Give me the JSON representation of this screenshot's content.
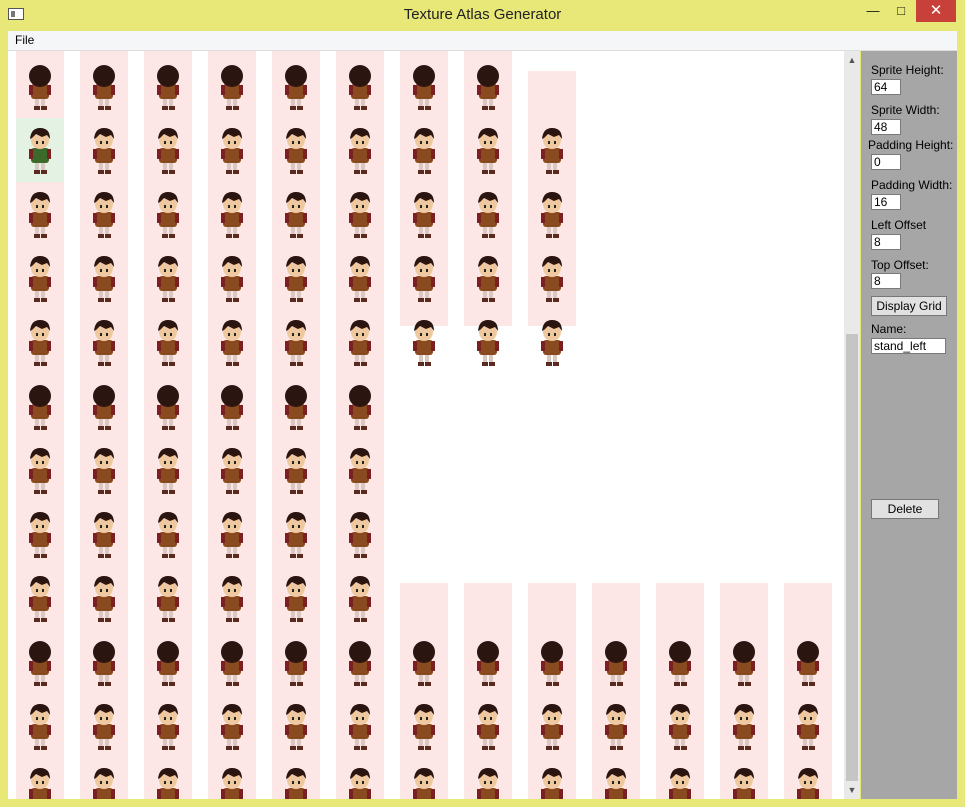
{
  "window": {
    "title": "Texture Atlas Generator",
    "minimize": "—",
    "maximize": "□",
    "close": "✕"
  },
  "menu": {
    "file": "File"
  },
  "sheet": {
    "columns": 13,
    "column_row_counts": [
      12,
      12,
      12,
      12,
      12,
      12,
      12,
      12,
      12,
      12,
      12,
      12,
      12
    ],
    "selected_cell": {
      "col": 0,
      "row": 1
    },
    "skin_color": "#f0c8a0",
    "hair_color": "#2a1510",
    "tunic_color": "#8a4a20",
    "highlight_color": "#fde6e6",
    "selected_color": "#e3f2e3"
  },
  "panel": {
    "sprite_height_label": "Sprite Height:",
    "sprite_height_value": "64",
    "sprite_width_label": "Sprite Width:",
    "sprite_width_value": "48",
    "padding_height_label": "Padding Height:",
    "padding_height_value": "0",
    "padding_width_label": "Padding Width:",
    "padding_width_value": "16",
    "left_offset_label": "Left Offset",
    "left_offset_value": "8",
    "top_offset_label": "Top Offset:",
    "top_offset_value": "8",
    "display_grid_label": "Display Grid",
    "name_label": "Name:",
    "name_value": "stand_left",
    "delete_label": "Delete"
  },
  "scrollbar": {
    "up": "▲",
    "down": "▼"
  }
}
